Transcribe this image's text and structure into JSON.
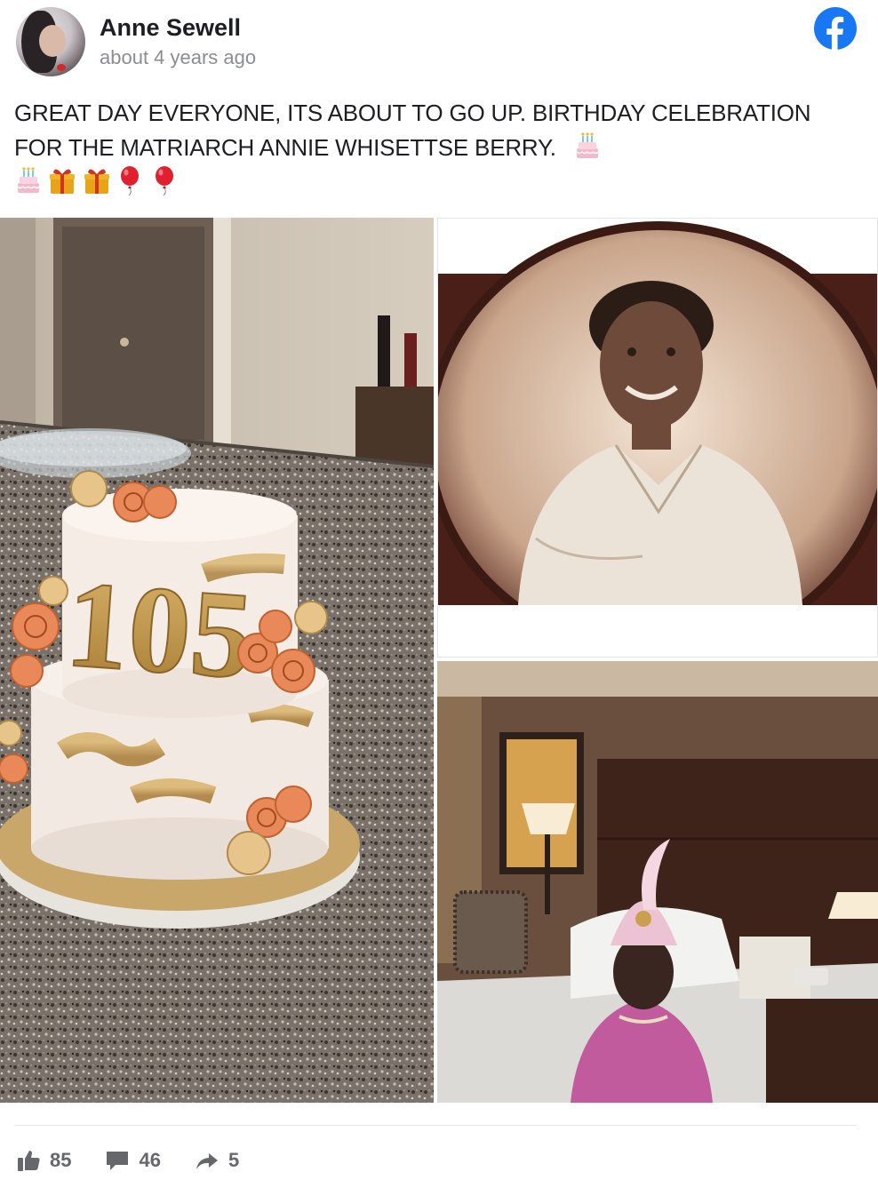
{
  "post": {
    "author_name": "Anne Sewell",
    "timestamp": "about 4 years ago",
    "text": "GREAT DAY EVERYONE, ITS ABOUT TO GO UP. BIRTHDAY CELEBRATION FOR THE MATRIARCH ANNIE WHISETTSE BERRY.",
    "trailing_emojis": [
      "birthday-cake",
      "birthday-cake",
      "wrapped-gift",
      "wrapped-gift",
      "red-balloon",
      "red-balloon"
    ],
    "platform_icon": "facebook-icon"
  },
  "photos": [
    {
      "name": "photo-birthday-cake",
      "cake_number": "105"
    },
    {
      "name": "photo-vintage-portrait"
    },
    {
      "name": "photo-hotel-room"
    }
  ],
  "footer": {
    "likes": "85",
    "comments": "46",
    "shares": "5"
  },
  "colors": {
    "text": "#1c1e21",
    "muted": "#8a8d91",
    "facebook_blue": "#1877f2",
    "action_gray": "#65676b"
  }
}
